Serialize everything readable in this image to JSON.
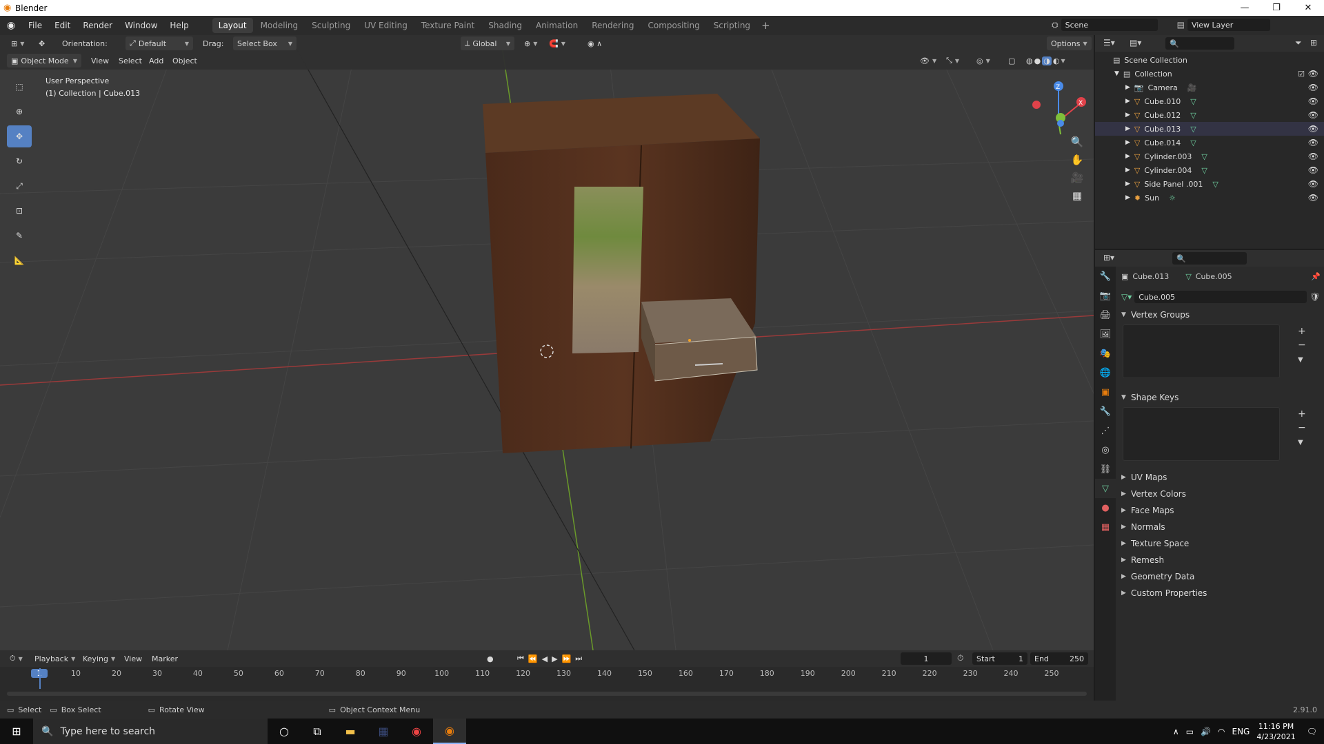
{
  "window": {
    "title": "Blender",
    "minimize": "—",
    "restore": "❐",
    "close": "✕"
  },
  "menu": [
    "File",
    "Edit",
    "Render",
    "Window",
    "Help"
  ],
  "workspaces": [
    "Layout",
    "Modeling",
    "Sculpting",
    "UV Editing",
    "Texture Paint",
    "Shading",
    "Animation",
    "Rendering",
    "Compositing",
    "Scripting"
  ],
  "active_workspace": "Layout",
  "scene": {
    "label": "Scene",
    "view_layer": "View Layer"
  },
  "viewport_header": {
    "orientation_label": "Orientation:",
    "orientation_value": "Default",
    "drag_label": "Drag:",
    "drag_value": "Select Box",
    "transform_orientation": "Global",
    "options": "Options",
    "mode": "Object Mode",
    "menus": [
      "View",
      "Select",
      "Add",
      "Object"
    ]
  },
  "viewport_info": {
    "perspective": "User Perspective",
    "collection": "(1) Collection | Cube.013"
  },
  "gizmo": {
    "z": "Z",
    "y": "Y",
    "x": "X"
  },
  "outliner": {
    "root": "Scene Collection",
    "collection": "Collection",
    "items": [
      {
        "name": "Camera",
        "type": "camera"
      },
      {
        "name": "Cube.010",
        "type": "mesh"
      },
      {
        "name": "Cube.012",
        "type": "mesh"
      },
      {
        "name": "Cube.013",
        "type": "mesh"
      },
      {
        "name": "Cube.014",
        "type": "mesh"
      },
      {
        "name": "Cylinder.003",
        "type": "mesh"
      },
      {
        "name": "Cylinder.004",
        "type": "mesh"
      },
      {
        "name": "Side Panel .001",
        "type": "mesh"
      },
      {
        "name": "Sun",
        "type": "light"
      }
    ]
  },
  "properties": {
    "object_name": "Cube.013",
    "data_name": "Cube.005",
    "mesh_field": "Cube.005",
    "sections_open": [
      "Vertex Groups",
      "Shape Keys"
    ],
    "sections_closed": [
      "UV Maps",
      "Vertex Colors",
      "Face Maps",
      "Normals",
      "Texture Space",
      "Remesh",
      "Geometry Data",
      "Custom Properties"
    ]
  },
  "timeline": {
    "menus": [
      "Playback",
      "Keying",
      "View",
      "Marker"
    ],
    "current_frame": "1",
    "start_label": "Start",
    "start": "1",
    "end_label": "End",
    "end": "250",
    "ticks": [
      "1",
      "10",
      "20",
      "30",
      "40",
      "50",
      "60",
      "70",
      "80",
      "90",
      "100",
      "110",
      "120",
      "130",
      "140",
      "150",
      "160",
      "170",
      "180",
      "190",
      "200",
      "210",
      "220",
      "230",
      "240",
      "250"
    ]
  },
  "statusbar": {
    "select": "Select",
    "box_select": "Box Select",
    "rotate_view": "Rotate View",
    "context_menu": "Object Context Menu",
    "version": "2.91.0"
  },
  "taskbar": {
    "search_placeholder": "Type here to search",
    "lang": "ENG",
    "time": "11:16 PM",
    "date": "4/23/2021"
  },
  "colors": {
    "accent": "#5581c3",
    "active_tab": "#3d3d3d",
    "axis_x": "#e0424a",
    "axis_y": "#7fbf3a",
    "axis_z": "#4a8be8"
  }
}
